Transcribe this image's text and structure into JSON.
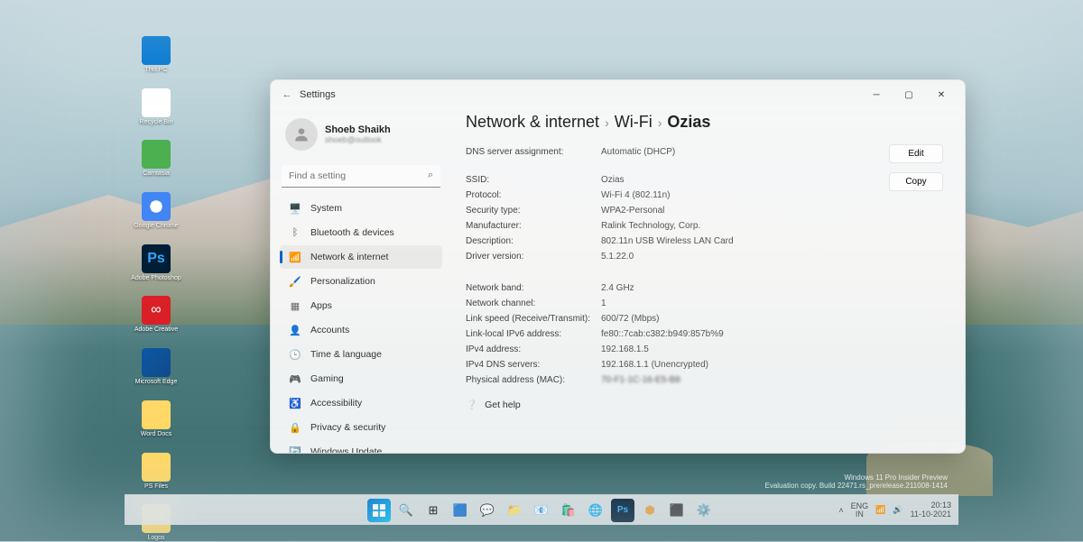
{
  "desktop": {
    "icons": [
      {
        "label": "This PC",
        "cls": "ico-blue"
      },
      {
        "label": "Recycle Bin",
        "cls": "ico-recycle"
      },
      {
        "label": "Camtasia",
        "cls": "ico-green"
      },
      {
        "label": "Google Chrome",
        "cls": "ico-chrome"
      },
      {
        "label": "Adobe Photoshop",
        "cls": "ico-ps",
        "txt": "Ps"
      },
      {
        "label": "Adobe Creative",
        "cls": "ico-cc",
        "txt": "∞"
      },
      {
        "label": "Microsoft Edge",
        "cls": "ico-edge"
      },
      {
        "label": "Word Docs",
        "cls": "ico-folder"
      },
      {
        "label": "PS Files",
        "cls": "ico-folder"
      },
      {
        "label": "Logos",
        "cls": "ico-folder"
      }
    ]
  },
  "window": {
    "title": "Settings",
    "user": {
      "name": "Shoeb Shaikh",
      "email": "shoeb@outlook"
    },
    "search_placeholder": "Find a setting",
    "nav": [
      {
        "icon": "🖥️",
        "label": "System",
        "color": "#0078d4"
      },
      {
        "icon": "ᛒ",
        "label": "Bluetooth & devices",
        "color": "#555"
      },
      {
        "icon": "📶",
        "label": "Network & internet",
        "color": "#0078d4",
        "active": true
      },
      {
        "icon": "🖌️",
        "label": "Personalization",
        "color": "#d97b3f"
      },
      {
        "icon": "▦",
        "label": "Apps",
        "color": "#666"
      },
      {
        "icon": "👤",
        "label": "Accounts",
        "color": "#3a8"
      },
      {
        "icon": "🕒",
        "label": "Time & language",
        "color": "#555"
      },
      {
        "icon": "🎮",
        "label": "Gaming",
        "color": "#555"
      },
      {
        "icon": "♿",
        "label": "Accessibility",
        "color": "#3a8dde"
      },
      {
        "icon": "🔒",
        "label": "Privacy & security",
        "color": "#555"
      },
      {
        "icon": "🔄",
        "label": "Windows Update",
        "color": "#0078d4"
      }
    ],
    "breadcrumb": [
      "Network & internet",
      "Wi-Fi",
      "Ozias"
    ],
    "actions": {
      "edit": "Edit",
      "copy": "Copy"
    },
    "section1": [
      {
        "k": "DNS server assignment:",
        "v": "Automatic (DHCP)"
      }
    ],
    "section2": [
      {
        "k": "SSID:",
        "v": "Ozias"
      },
      {
        "k": "Protocol:",
        "v": "Wi-Fi 4 (802.11n)"
      },
      {
        "k": "Security type:",
        "v": "WPA2-Personal"
      },
      {
        "k": "Manufacturer:",
        "v": "Ralink Technology, Corp."
      },
      {
        "k": "Description:",
        "v": "802.11n USB Wireless LAN Card"
      },
      {
        "k": "Driver version:",
        "v": "5.1.22.0"
      }
    ],
    "section3": [
      {
        "k": "Network band:",
        "v": "2.4 GHz"
      },
      {
        "k": "Network channel:",
        "v": "1"
      },
      {
        "k": "Link speed (Receive/Transmit):",
        "v": "600/72 (Mbps)"
      },
      {
        "k": "Link-local IPv6 address:",
        "v": "fe80::7cab:c382:b949:857b%9"
      },
      {
        "k": "IPv4 address:",
        "v": "192.168.1.5"
      },
      {
        "k": "IPv4 DNS servers:",
        "v": "192.168.1.1 (Unencrypted)"
      },
      {
        "k": "Physical address (MAC):",
        "v": "70-F1-1C-16-E5-B8",
        "blur": true
      }
    ],
    "help": "Get help"
  },
  "taskbar": {
    "lang1": "ENG",
    "lang2": "IN",
    "time": "20:13",
    "date": "11-10-2021"
  },
  "watermark": {
    "l1": "Windows 11 Pro Insider Preview",
    "l2": "Evaluation copy. Build 22471.rs_prerelease.211008-1414"
  }
}
